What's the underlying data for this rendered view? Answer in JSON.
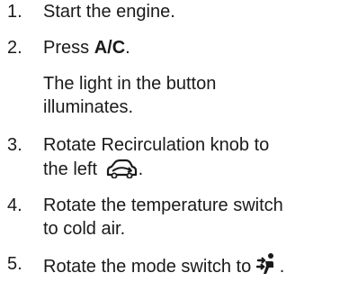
{
  "steps": [
    {
      "number": "1.",
      "text": "Start the engine."
    },
    {
      "number": "2.",
      "prefix": "Press ",
      "bold": "A/C",
      "suffix": "."
    },
    {
      "note": "The light in the button illuminates."
    },
    {
      "number": "3.",
      "line1": "Rotate Recirculation knob to",
      "line2": "the left",
      "icon": "recirculation-car-icon",
      "suffix": "."
    },
    {
      "number": "4.",
      "line1": "Rotate the temperature switch",
      "line2": "to cold air."
    },
    {
      "number": "5.",
      "text": "Rotate the mode switch to",
      "icon": "vent-airflow-icon",
      "suffix": "."
    }
  ]
}
